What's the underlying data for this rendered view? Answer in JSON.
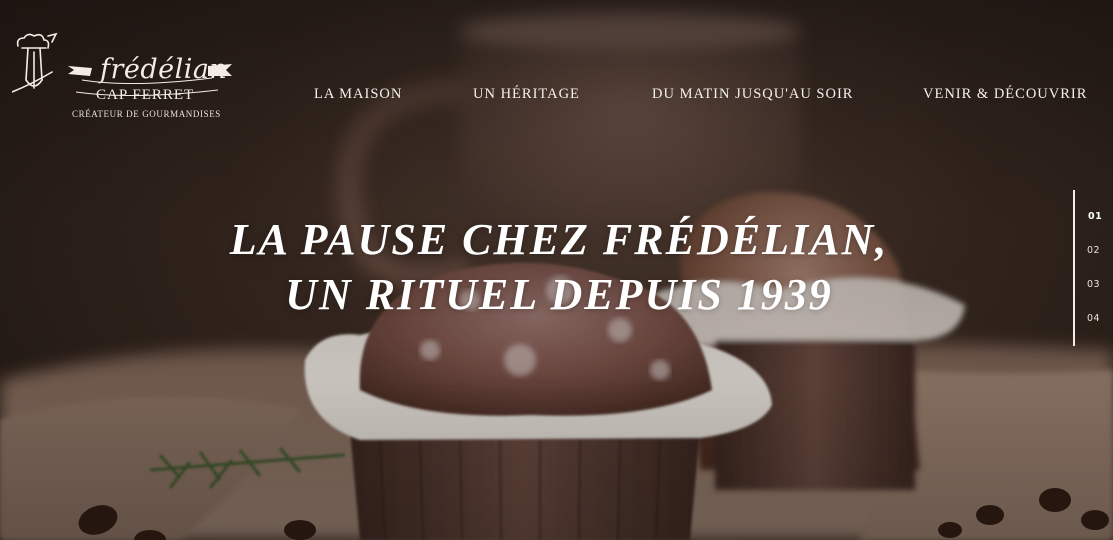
{
  "brand": {
    "script_name": "frédélian",
    "city": "CAP FERRET",
    "tagline": "CRÉATEUR DE GOURMANDISES"
  },
  "nav": {
    "items": [
      {
        "label": "LA MAISON"
      },
      {
        "label": "UN HÉRITAGE"
      },
      {
        "label": "DU MATIN JUSQU'AU SOIR"
      },
      {
        "label": "VENIR & DÉCOUVRIR"
      }
    ]
  },
  "hero": {
    "headline_line1": "LA PAUSE CHEZ FRÉDÉLIAN,",
    "headline_line2": "UN RITUEL DEPUIS 1939",
    "image": "muffins-and-coffee-mug-photo"
  },
  "pager": {
    "items": [
      "01",
      "02",
      "03",
      "04"
    ],
    "active_index": 0
  },
  "colors": {
    "text": "#ffffff",
    "background_dark": "#2a1e18",
    "muffin_brown": "#6b4030",
    "paper_cup": "#e8e2dc"
  }
}
